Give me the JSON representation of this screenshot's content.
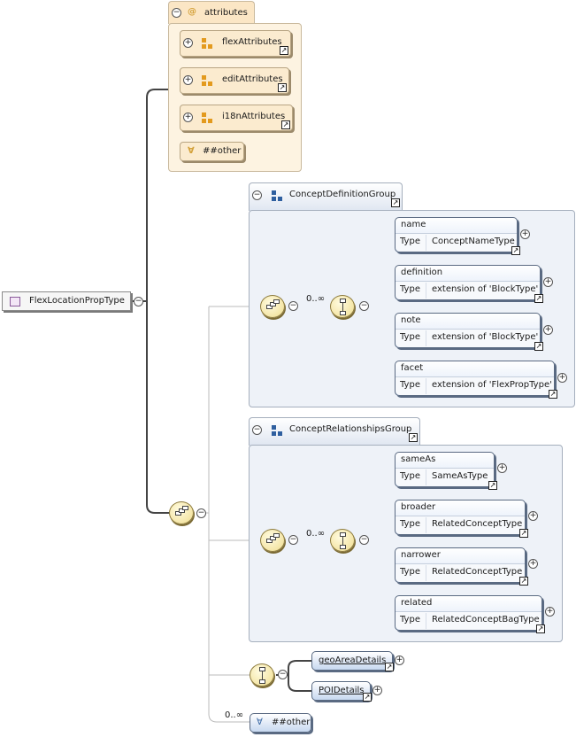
{
  "root": {
    "label": "FlexLocationPropType"
  },
  "attributes": {
    "tab_label": "attributes",
    "groups": [
      {
        "label": "flexAttributes"
      },
      {
        "label": "editAttributes"
      },
      {
        "label": "i18nAttributes"
      }
    ],
    "other_label": "##other"
  },
  "concept_definition": {
    "tab_label": "ConceptDefinitionGroup",
    "occurrence": "0..∞",
    "elements": [
      {
        "name": "name",
        "type_label": "Type",
        "type": "ConceptNameType"
      },
      {
        "name": "definition",
        "type_label": "Type",
        "type": "extension of 'BlockType'"
      },
      {
        "name": "note",
        "type_label": "Type",
        "type": "extension of 'BlockType'"
      },
      {
        "name": "facet",
        "type_label": "Type",
        "type": "extension of 'FlexPropType'"
      }
    ]
  },
  "concept_relationships": {
    "tab_label": "ConceptRelationshipsGroup",
    "occurrence": "0..∞",
    "elements": [
      {
        "name": "sameAs",
        "type_label": "Type",
        "type": "SameAsType"
      },
      {
        "name": "broader",
        "type_label": "Type",
        "type": "RelatedConceptType"
      },
      {
        "name": "narrower",
        "type_label": "Type",
        "type": "RelatedConceptType"
      },
      {
        "name": "related",
        "type_label": "Type",
        "type": "RelatedConceptBagType"
      }
    ]
  },
  "choice_refs": [
    {
      "label": "geoAreaDetails"
    },
    {
      "label": "POIDetails"
    }
  ],
  "any_other": {
    "occurrence": "0..∞",
    "label": "##other"
  },
  "glyphs": {
    "expand": "+",
    "collapse": "−",
    "ref_arrow": "↗",
    "at": "@",
    "any": "∀"
  }
}
